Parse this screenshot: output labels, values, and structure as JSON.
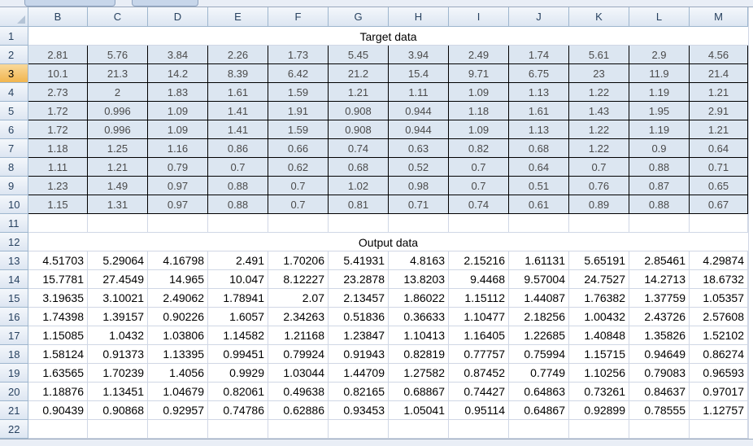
{
  "columns": [
    "B",
    "C",
    "D",
    "E",
    "F",
    "G",
    "H",
    "I",
    "J",
    "K",
    "L",
    "M"
  ],
  "rows": [
    "1",
    "2",
    "3",
    "4",
    "5",
    "6",
    "7",
    "8",
    "9",
    "10",
    "11",
    "12",
    "13",
    "14",
    "15",
    "16",
    "17",
    "18",
    "19",
    "20",
    "21",
    "22"
  ],
  "selected_row": "3",
  "target_title": "Target data",
  "output_title": "Output data",
  "target_data": [
    [
      "2.81",
      "5.76",
      "3.84",
      "2.26",
      "1.73",
      "5.45",
      "3.94",
      "2.49",
      "1.74",
      "5.61",
      "2.9",
      "4.56"
    ],
    [
      "10.1",
      "21.3",
      "14.2",
      "8.39",
      "6.42",
      "21.2",
      "15.4",
      "9.71",
      "6.75",
      "23",
      "11.9",
      "21.4"
    ],
    [
      "2.73",
      "2",
      "1.83",
      "1.61",
      "1.59",
      "1.21",
      "1.11",
      "1.09",
      "1.13",
      "1.22",
      "1.19",
      "1.21"
    ],
    [
      "1.72",
      "0.996",
      "1.09",
      "1.41",
      "1.91",
      "0.908",
      "0.944",
      "1.18",
      "1.61",
      "1.43",
      "1.95",
      "2.91"
    ],
    [
      "1.72",
      "0.996",
      "1.09",
      "1.41",
      "1.59",
      "0.908",
      "0.944",
      "1.09",
      "1.13",
      "1.22",
      "1.19",
      "1.21"
    ],
    [
      "1.18",
      "1.25",
      "1.16",
      "0.86",
      "0.66",
      "0.74",
      "0.63",
      "0.82",
      "0.68",
      "1.22",
      "0.9",
      "0.64"
    ],
    [
      "1.11",
      "1.21",
      "0.79",
      "0.7",
      "0.62",
      "0.68",
      "0.52",
      "0.7",
      "0.64",
      "0.7",
      "0.88",
      "0.71"
    ],
    [
      "1.23",
      "1.49",
      "0.97",
      "0.88",
      "0.7",
      "1.02",
      "0.98",
      "0.7",
      "0.51",
      "0.76",
      "0.87",
      "0.65"
    ],
    [
      "1.15",
      "1.31",
      "0.97",
      "0.88",
      "0.7",
      "0.81",
      "0.71",
      "0.74",
      "0.61",
      "0.89",
      "0.88",
      "0.67"
    ]
  ],
  "output_data": [
    [
      "4.51703",
      "5.29064",
      "4.16798",
      "2.491",
      "1.70206",
      "5.41931",
      "4.8163",
      "2.15216",
      "1.61131",
      "5.65191",
      "2.85461",
      "4.29874"
    ],
    [
      "15.7781",
      "27.4549",
      "14.965",
      "10.047",
      "8.12227",
      "23.2878",
      "13.8203",
      "9.4468",
      "9.57004",
      "24.7527",
      "14.2713",
      "18.6732"
    ],
    [
      "3.19635",
      "3.10021",
      "2.49062",
      "1.78941",
      "2.07",
      "2.13457",
      "1.86022",
      "1.15112",
      "1.44087",
      "1.76382",
      "1.37759",
      "1.05357"
    ],
    [
      "1.74398",
      "1.39157",
      "0.90226",
      "1.6057",
      "2.34263",
      "0.51836",
      "0.36633",
      "1.10477",
      "2.18256",
      "1.00432",
      "2.43726",
      "2.57608"
    ],
    [
      "1.15085",
      "1.0432",
      "1.03806",
      "1.14582",
      "1.21168",
      "1.23847",
      "1.10413",
      "1.16405",
      "1.22685",
      "1.40848",
      "1.35826",
      "1.52102"
    ],
    [
      "1.58124",
      "0.91373",
      "1.13395",
      "0.99451",
      "0.79924",
      "0.91943",
      "0.82819",
      "0.77757",
      "0.75994",
      "1.15715",
      "0.94649",
      "0.86274"
    ],
    [
      "1.63565",
      "1.70239",
      "1.4056",
      "0.9929",
      "1.03044",
      "1.44709",
      "1.27582",
      "0.87452",
      "0.7749",
      "1.10256",
      "0.79083",
      "0.96593"
    ],
    [
      "1.18876",
      "1.13451",
      "1.04679",
      "0.82061",
      "0.49638",
      "0.82165",
      "0.68867",
      "0.74427",
      "0.64863",
      "0.73261",
      "0.84637",
      "0.97017"
    ],
    [
      "0.90439",
      "0.90868",
      "0.92957",
      "0.74786",
      "0.62886",
      "0.93453",
      "1.05041",
      "0.95114",
      "0.64867",
      "0.92899",
      "0.78555",
      "1.12757"
    ]
  ]
}
